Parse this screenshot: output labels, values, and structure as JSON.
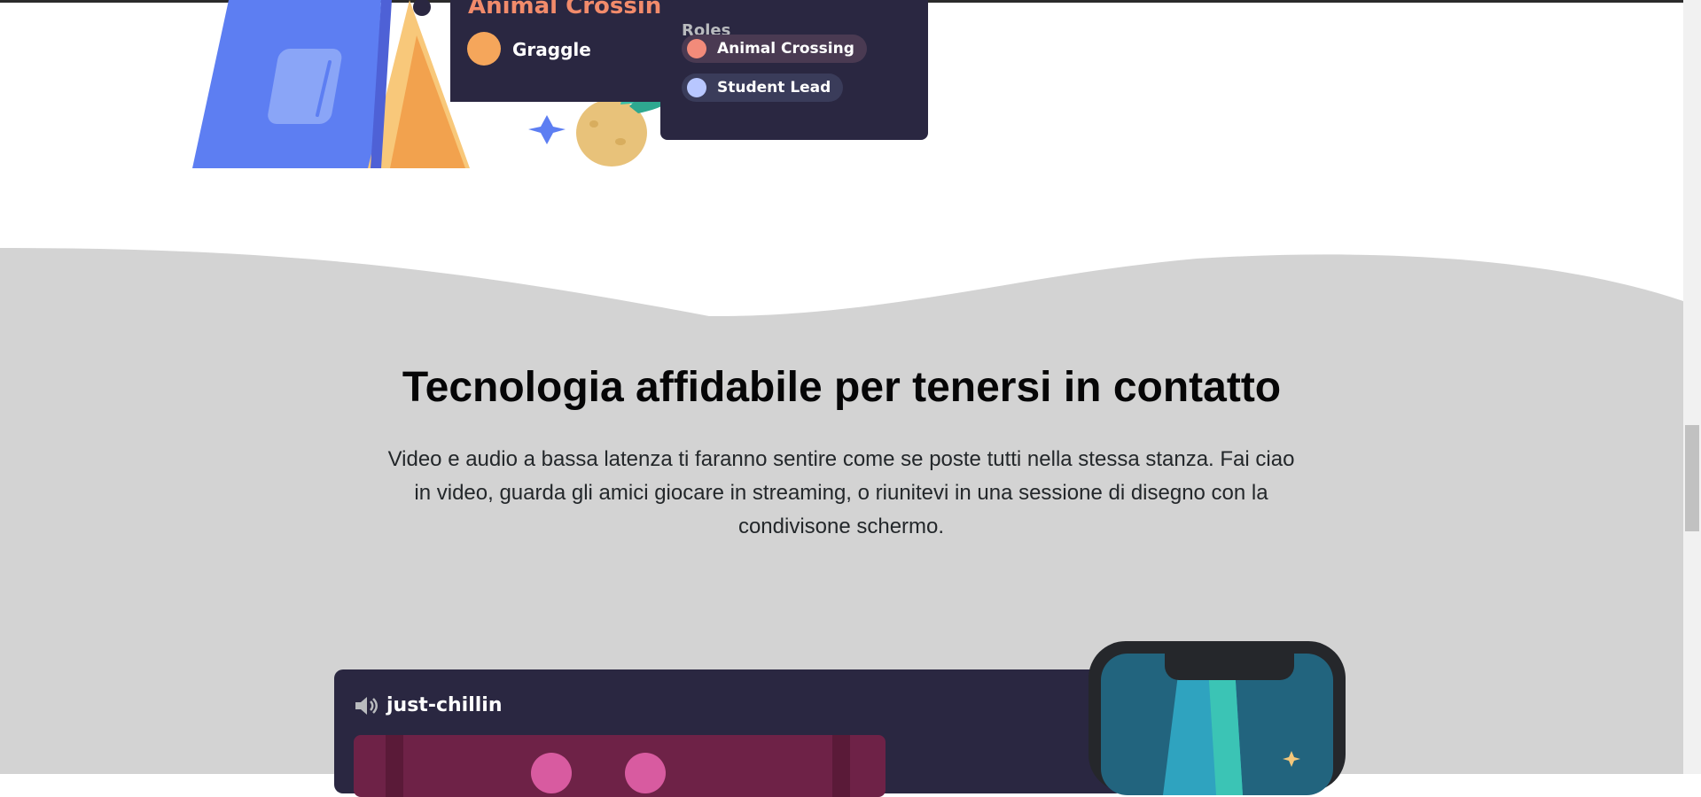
{
  "server_card": {
    "channel_name": "Animal Crossing",
    "user_name": "Graggle"
  },
  "roles_card": {
    "title": "Roles",
    "roles": [
      {
        "label": "Animal Crossing",
        "color": "#f28b7a"
      },
      {
        "label": "Student Lead",
        "color": "#b8c7ff"
      }
    ]
  },
  "section": {
    "headline": "Tecnologia affidabile per tenersi in contatto",
    "body": "Video e audio a bassa latenza ti faranno sentire come se poste tutti nella stessa stanza. Fai ciao in video, guarda gli amici giocare in streaming, o riunitevi in una sessione di disegno con la condivisone schermo."
  },
  "voice_card": {
    "channel_name": "just-chillin",
    "icon": "speaker-icon"
  },
  "colors": {
    "card_bg": "#2a2741",
    "section_bg": "#d3d3d3",
    "blurple": "#5a7cf2",
    "accent_orange": "#f28b6b"
  }
}
